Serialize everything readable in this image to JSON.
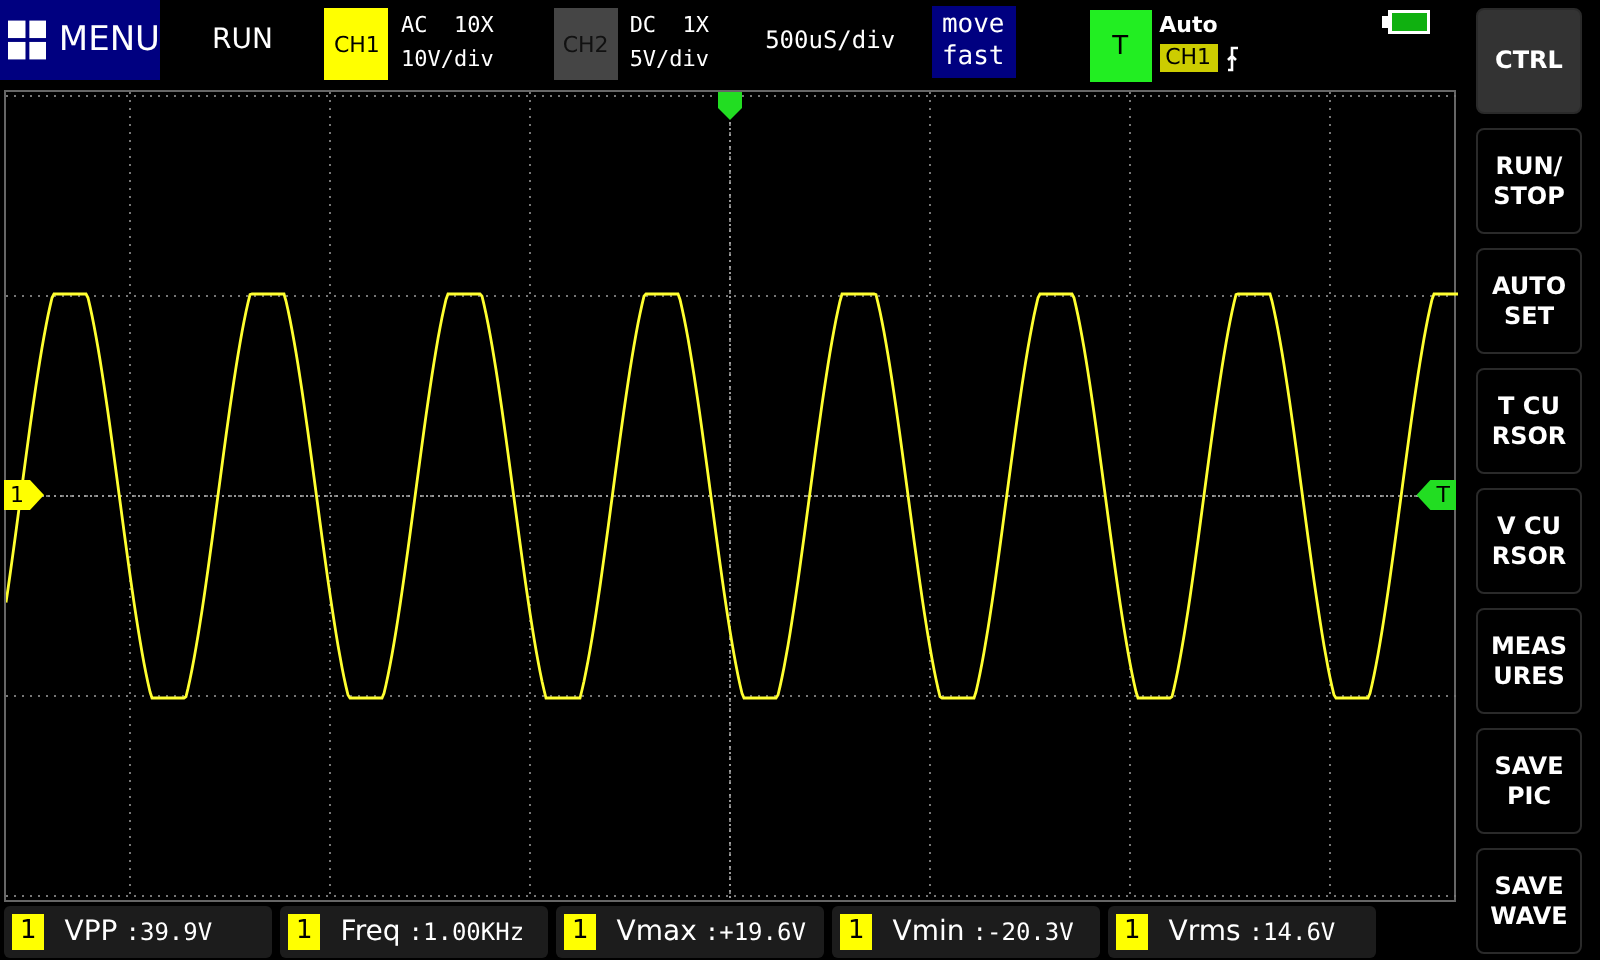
{
  "top_bar": {
    "menu": "MENU",
    "run_state": "RUN",
    "channels": [
      {
        "label": "CH1",
        "coupling": "AC  10X",
        "scale": "10V/div",
        "enabled": true
      },
      {
        "label": "CH2",
        "coupling": "DC  1X",
        "scale": "5V/div",
        "enabled": false
      }
    ],
    "timebase": "500uS/div",
    "move_mode": "move fast",
    "trigger": {
      "label": "T",
      "mode": "Auto",
      "source": "CH1"
    }
  },
  "markers": {
    "channel": "1",
    "trigger": "T"
  },
  "side_buttons": [
    "CTRL",
    "RUN/ STOP",
    "AUTO SET",
    "T  CU RSOR",
    "V  CU RSOR",
    "MEAS URES",
    "SAVE PIC",
    "SAVE WAVE"
  ],
  "measurements": [
    {
      "channel": "1",
      "label": "VPP",
      "value": ":39.9V"
    },
    {
      "channel": "1",
      "label": "Freq",
      "value": ":1.00KHz"
    },
    {
      "channel": "1",
      "label": "Vmax",
      "value": ":+19.6V"
    },
    {
      "channel": "1",
      "label": "Vmin",
      "value": ":-20.3V"
    },
    {
      "channel": "1",
      "label": "Vrms",
      "value": ":14.6V"
    }
  ]
}
